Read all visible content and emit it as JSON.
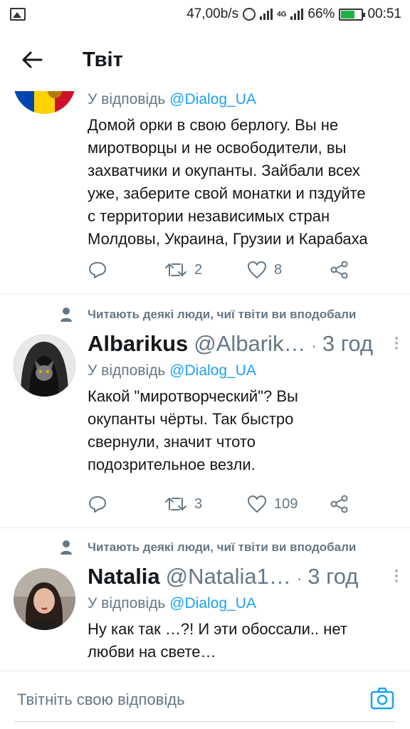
{
  "status_bar": {
    "net_speed": "47,00b/s",
    "network": "4G",
    "battery": "66%",
    "battery_level": 0.66,
    "time": "00:51"
  },
  "header": {
    "title": "Твіт"
  },
  "tweets": [
    {
      "reply_prefix": "У відповідь",
      "reply_to": "@Dialog_UA",
      "text": "Домой орки в свою берлогу. Вы не\nмиротворцы и не освободители, вы\nзахватчики и окупанты. Зайбали всех\nуже, заберите свой монатки и пздуйте\nс территории независимых стран\nМолдовы, Украина, Грузии и Карабаха",
      "retweets": "2",
      "likes": "8",
      "avatar_icon": "flag-avatar"
    },
    {
      "context": "Читають деякі люди, чиї твіти ви вподобали",
      "name": "Albarikus",
      "handle": "@Albarik…",
      "dot": "·",
      "time": "3 год",
      "reply_prefix": "У відповідь",
      "reply_to": "@Dialog_UA",
      "text": "Какой \"миротворческий\"? Вы\nокупанты чёрты. Так быстро\nсвернули, значит чтото\nподозрительное везли.",
      "retweets": "3",
      "likes": "109",
      "avatar_icon": "hooded-cat-avatar"
    },
    {
      "context": "Читають деякі люди, чиї твіти ви вподобали",
      "name": "Natalia",
      "handle": "@Natalia1…",
      "dot": "·",
      "time": "3 год",
      "reply_prefix": "У відповідь",
      "reply_to": "@Dialog_UA",
      "text": "Ну как так …?! И эти обоссали.. нет\nлюбви на свете…",
      "avatar_icon": "woman-avatar"
    }
  ],
  "composer": {
    "placeholder": "Твітніть свою відповідь"
  },
  "colors": {
    "accent": "#1da1f2",
    "muted": "#657786",
    "text": "#14171a",
    "divider": "#e6ecf0"
  }
}
